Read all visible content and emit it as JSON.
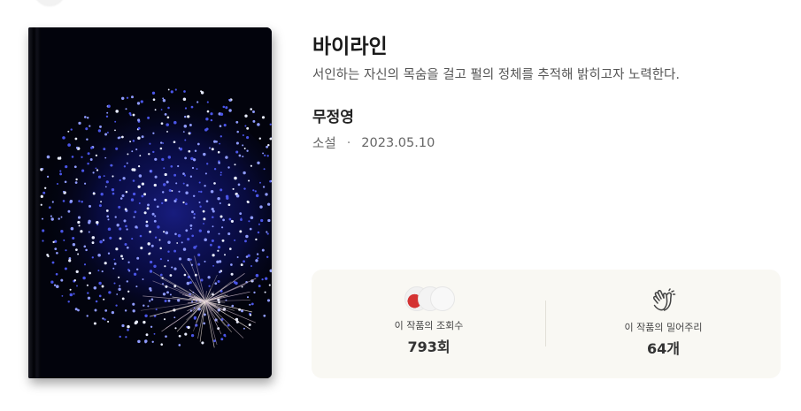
{
  "work": {
    "title": "바이라인",
    "description": "서인하는 자신의 목숨을 걸고 펄의 정체를 추적해 밝히고자 노력한다.",
    "author": "무정영",
    "genre": "소설",
    "separator": "·",
    "date": "2023.05.10"
  },
  "stats": {
    "views": {
      "label": "이 작품의 조회수",
      "value": "793회",
      "icon": "reader-avatars-icon"
    },
    "pushes": {
      "label": "이 작품의 밀어주리",
      "value": "64개",
      "icon": "clap-icon"
    }
  },
  "colors": {
    "stats_background": "#f9f8f3",
    "cover_background": "#02030c",
    "firework_blue": "#5a6bff"
  }
}
